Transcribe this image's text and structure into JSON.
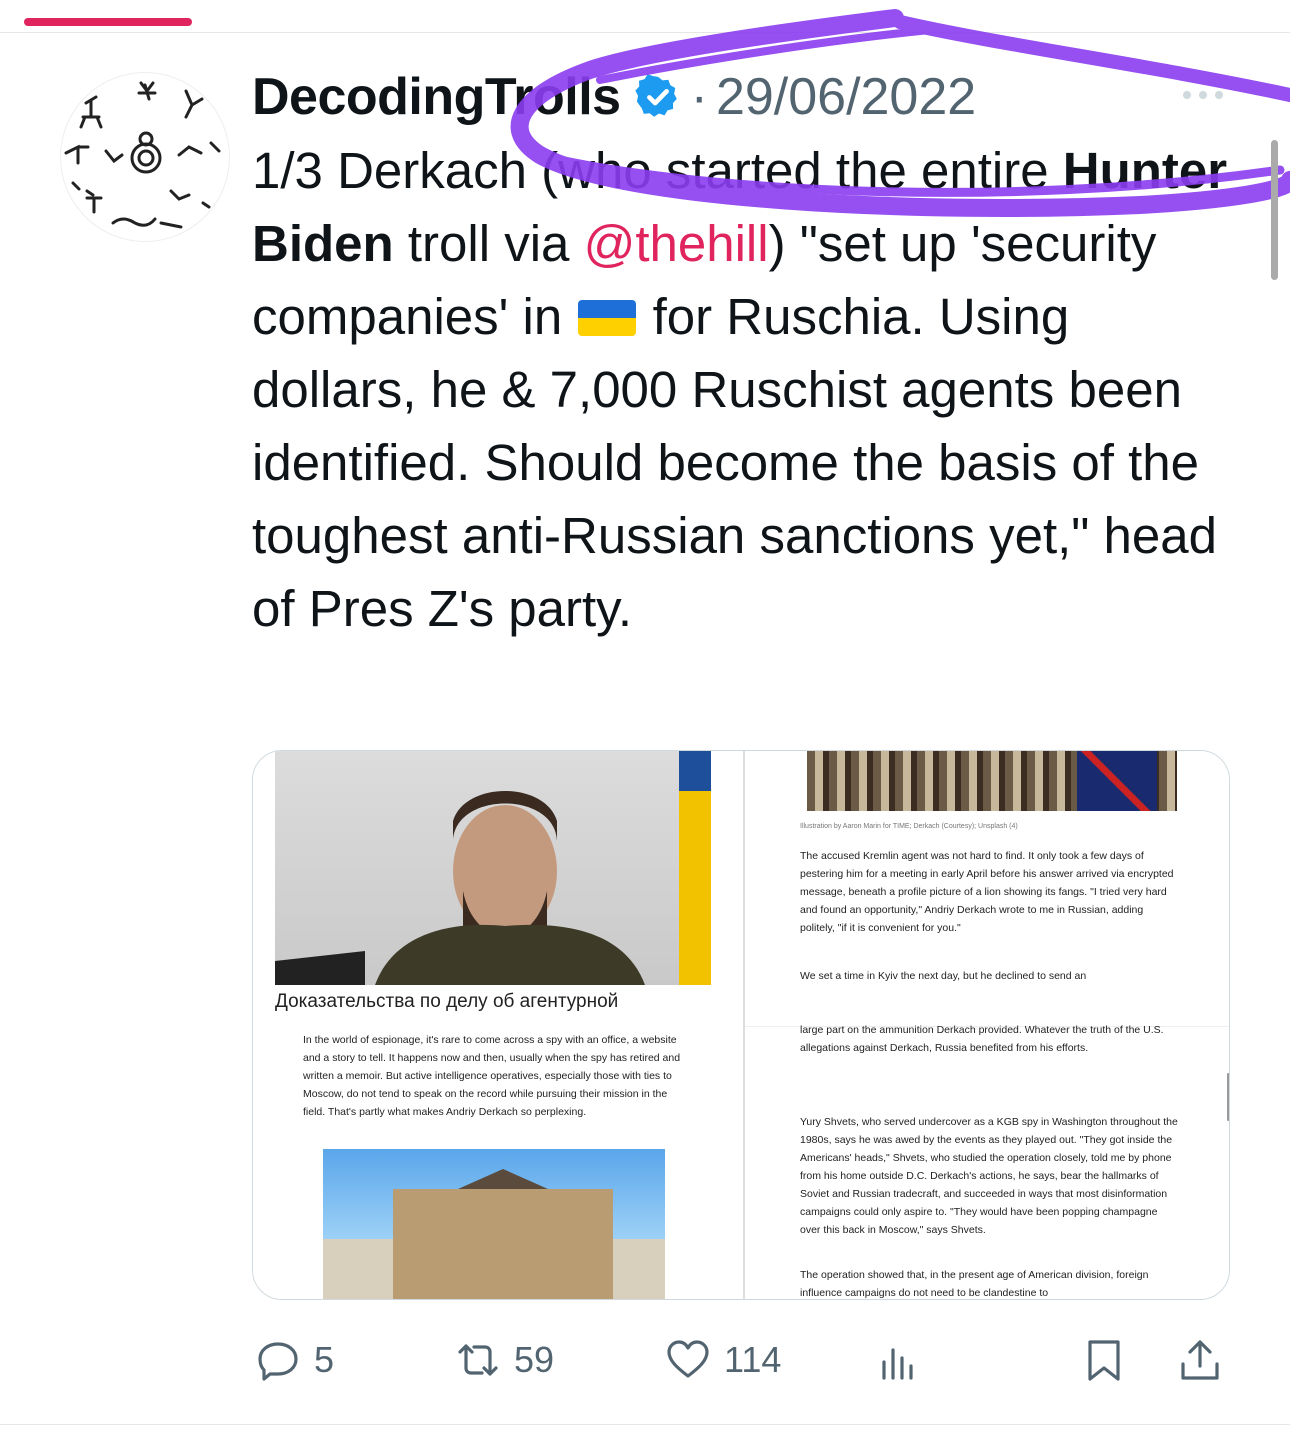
{
  "tweet": {
    "author_name": "DecodingTrolls",
    "date": "29/06/2022",
    "separator": "·",
    "text_parts": {
      "p1": "1/3 Derkach (who started the entire ",
      "bold": "Hunter Biden",
      "p2": " troll via ",
      "mention": "@thehill",
      "p3": ") \"set up 'security companies' in ",
      "p4": " for Ruschia. Using dollars, he & 7,000 Ruschist agents been identified. Should become the basis of the toughest anti-Russian sanctions yet,\" head of Pres Z's party."
    },
    "flag_icon": "ukraine-flag-emoji",
    "accent_color": "#e0245e",
    "verified_color": "#1d9bf0"
  },
  "media": {
    "left": {
      "caption_ru": "Доказательства по делу об агентурной",
      "paragraph": "In the world of espionage, it's rare to come across a spy with an office, a website and a story to tell. It happens now and then, usually when the spy has retired and written a memoir. But active intelligence operatives, especially those with ties to Moscow, do not tend to speak on the record while pursuing their mission in the field. That's partly what makes Andriy Derkach so perplexing."
    },
    "right": {
      "credit": "Illustration by Aaron Marin for TIME; Derkach (Courtesy); Unsplash (4)",
      "p1": "The accused Kremlin agent was not hard to find. It only took a few days of pestering him for a meeting in early April before his answer arrived via encrypted message, beneath a profile picture of a lion showing its fangs. \"I tried very hard and found an opportunity,\" Andriy Derkach wrote to me in Russian, adding politely, \"if it is convenient for you.\"",
      "p2": "We set a time in Kyiv the next day, but he declined to send an",
      "p3": "large part on the ammunition Derkach provided. Whatever the truth of the U.S. allegations against Derkach, Russia benefited from his efforts.",
      "p4": "Yury Shvets, who served undercover as a KGB spy in Washington throughout the 1980s, says he was awed by the events as they played out. \"They got inside the Americans' heads,\" Shvets, who studied the operation closely, told me by phone from his home outside D.C. Derkach's actions, he says, bear the hallmarks of Soviet and Russian tradecraft, and succeeded in ways that most disinformation campaigns could only aspire to. \"They would have been popping champagne over this back in Moscow,\" says Shvets.",
      "p5": "The operation showed that, in the present age of American division, foreign influence campaigns do not need to be clandestine to"
    }
  },
  "actions": {
    "replies": "5",
    "retweets": "59",
    "likes": "114",
    "icons": [
      "reply-icon",
      "retweet-icon",
      "like-icon",
      "views-icon",
      "bookmark-icon",
      "share-icon"
    ]
  }
}
